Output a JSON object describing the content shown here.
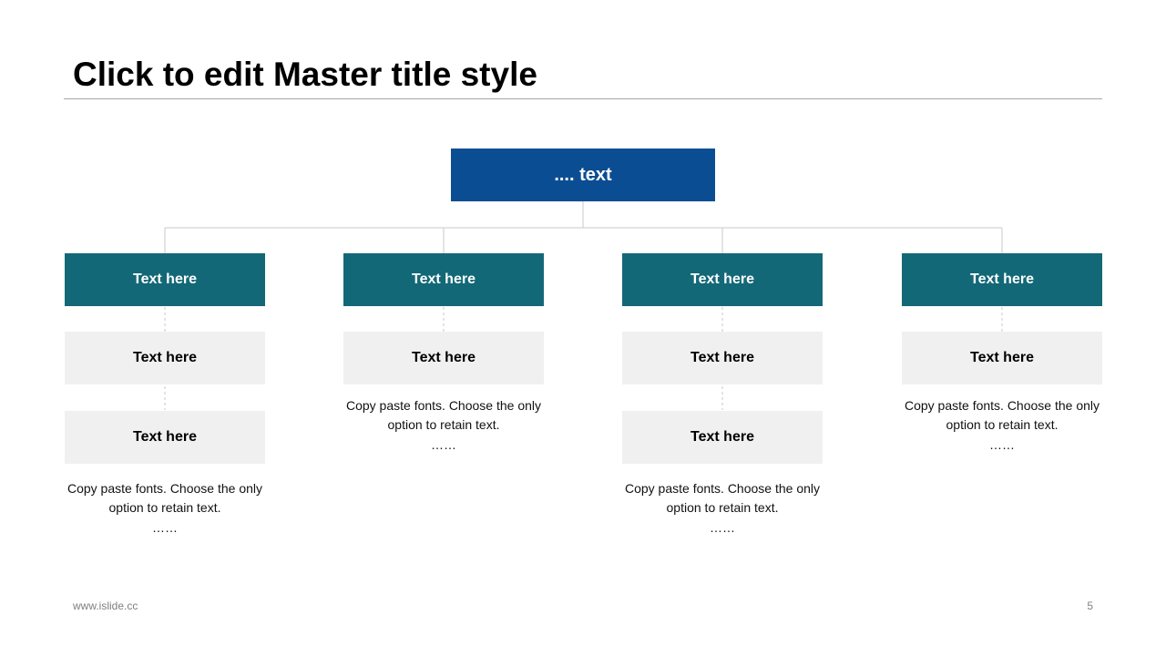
{
  "slide": {
    "title": "Click to edit Master title style",
    "footer_url": "www.islide.cc",
    "page_number": "5"
  },
  "diagram": {
    "root": {
      "label": ".... text"
    },
    "columns": [
      {
        "header": "Text here",
        "sub_boxes": [
          "Text here",
          "Text here"
        ],
        "description": "Copy paste fonts. Choose the only option to retain text.",
        "ellipsis": "……"
      },
      {
        "header": "Text here",
        "sub_boxes": [
          "Text here"
        ],
        "description": "Copy paste fonts. Choose the only option to retain text.",
        "ellipsis": "……"
      },
      {
        "header": "Text here",
        "sub_boxes": [
          "Text here",
          "Text here"
        ],
        "description": "Copy paste fonts. Choose the only option to retain text.",
        "ellipsis": "……"
      },
      {
        "header": "Text here",
        "sub_boxes": [
          "Text here"
        ],
        "description": "Copy paste fonts. Choose the only option to retain text.",
        "ellipsis": "……"
      }
    ]
  },
  "colors": {
    "root_fill": "#0b4d93",
    "header_fill": "#136877",
    "sub_box_fill": "#f0f0f0",
    "connector": "#c8c8c8"
  }
}
